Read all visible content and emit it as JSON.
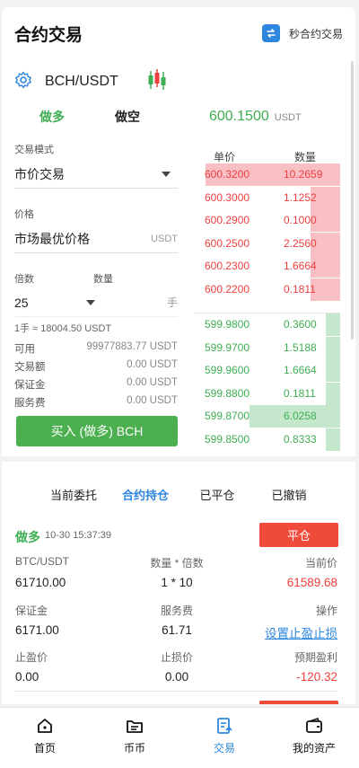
{
  "header": {
    "title": "合约交易",
    "second_contract_label": "秒合约交易"
  },
  "pair": {
    "name": "BCH/USDT"
  },
  "direction_tabs": {
    "long": "做多",
    "short": "做空"
  },
  "current_price": {
    "value": "600.1500",
    "unit": "USDT"
  },
  "form": {
    "trade_mode_label": "交易模式",
    "trade_mode_value": "市价交易",
    "price_label": "价格",
    "price_value": "市场最优价格",
    "price_unit": "USDT",
    "leverage_label": "倍数",
    "quantity_label": "数量",
    "leverage_value": "25",
    "quantity_unit": "手",
    "lot_info": "1手 ≈ 18004.50 USDT",
    "available_label": "可用",
    "available_value": "99977883.77 USDT",
    "amount_label": "交易额",
    "amount_value": "0.00 USDT",
    "margin_label": "保证金",
    "margin_value": "0.00 USDT",
    "fee_label": "服务费",
    "fee_value": "0.00 USDT",
    "buy_button": "买入 (做多) BCH"
  },
  "order_book": {
    "price_header": "单价",
    "qty_header": "数量",
    "asks": [
      {
        "price": "600.3200",
        "qty": "10.2659",
        "depth": 0.92
      },
      {
        "price": "600.3000",
        "qty": "1.1252",
        "depth": 0.2
      },
      {
        "price": "600.2900",
        "qty": "0.1000",
        "depth": 0.2
      },
      {
        "price": "600.2500",
        "qty": "2.2560",
        "depth": 0.2
      },
      {
        "price": "600.2300",
        "qty": "1.6664",
        "depth": 0.2
      },
      {
        "price": "600.2200",
        "qty": "0.1811",
        "depth": 0.2
      }
    ],
    "bids": [
      {
        "price": "599.9800",
        "qty": "0.3600",
        "depth": 0.1
      },
      {
        "price": "599.9700",
        "qty": "1.5188",
        "depth": 0.1
      },
      {
        "price": "599.9600",
        "qty": "1.6664",
        "depth": 0.1
      },
      {
        "price": "599.8800",
        "qty": "0.1811",
        "depth": 0.1
      },
      {
        "price": "599.8700",
        "qty": "6.0258",
        "depth": 0.62
      },
      {
        "price": "599.8500",
        "qty": "0.8333",
        "depth": 0.1
      }
    ]
  },
  "order_tabs": [
    "当前委托",
    "合约持仓",
    "已平仓",
    "已撤销"
  ],
  "position": {
    "side": "做多",
    "time": "10-30 15:37:39",
    "close_button": "平仓",
    "symbol_label": "BTC/USDT",
    "qty_leverage_label": "数量 * 倍数",
    "current_price_label": "当前价",
    "open_price": "61710.00",
    "qty_leverage": "1 * 10",
    "current_price": "61589.68",
    "margin_label": "保证金",
    "fee_label": "服务费",
    "action_label": "操作",
    "margin": "6171.00",
    "fee": "61.71",
    "action_link": "设置止盈止损",
    "tp_label": "止盈价",
    "sl_label": "止损价",
    "pnl_label": "预期盈利",
    "tp": "0.00",
    "sl": "0.00",
    "pnl": "-120.32"
  },
  "nav": [
    {
      "label": "首页",
      "icon": "home-icon"
    },
    {
      "label": "币币",
      "icon": "exchange-icon"
    },
    {
      "label": "交易",
      "icon": "trade-icon"
    },
    {
      "label": "我的资产",
      "icon": "wallet-icon"
    }
  ],
  "colors": {
    "green": "#3fae54",
    "red": "#ee3f3f",
    "blue": "#2e86de"
  }
}
